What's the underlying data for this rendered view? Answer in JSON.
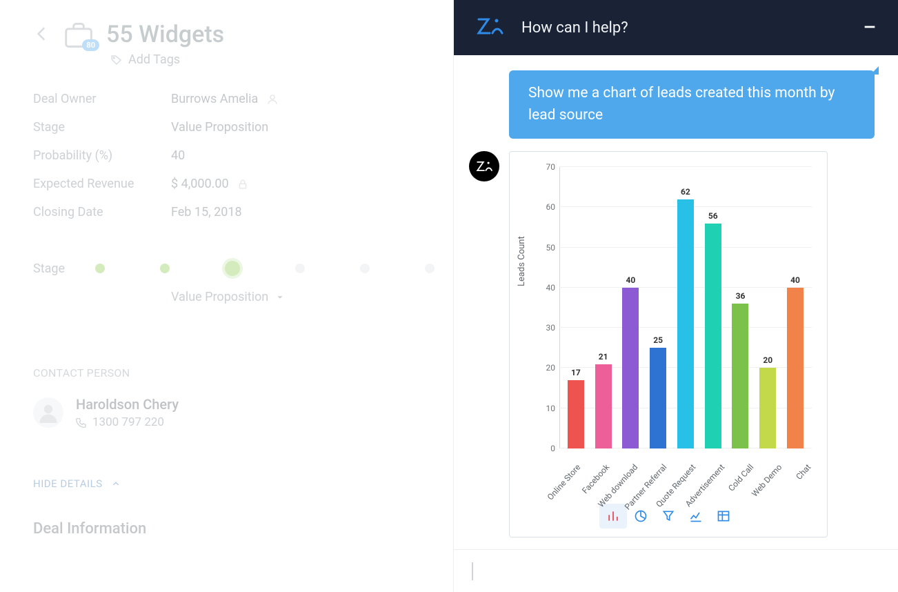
{
  "deal": {
    "title": "55 Widgets",
    "badge": "80",
    "add_tags_label": "Add Tags",
    "fields": {
      "owner_label": "Deal Owner",
      "owner_value": "Burrows Amelia",
      "stage_label": "Stage",
      "stage_value": "Value Proposition",
      "probability_label": "Probability (%)",
      "probability_value": "40",
      "revenue_label": "Expected Revenue",
      "revenue_value": "$ 4,000.00",
      "closing_label": "Closing Date",
      "closing_value": "Feb 15, 2018"
    },
    "stage_progress_label": "Stage",
    "stage_select_value": "Value Proposition",
    "contact_section": "CONTACT PERSON",
    "contact_name": "Haroldson Chery",
    "contact_phone": "1300 797 220",
    "hide_details": "HIDE DETAILS",
    "deal_info_heading": "Deal Information"
  },
  "zia": {
    "header_title": "How can I help?",
    "user_message": "Show me a chart of leads created this month by lead source"
  },
  "chart_data": {
    "type": "bar",
    "ylabel": "Leads Count",
    "ylim": [
      0,
      70
    ],
    "yticks": [
      0,
      10,
      20,
      30,
      40,
      50,
      60,
      70
    ],
    "categories": [
      "Online Store",
      "Facebook",
      "Web download",
      "Partner Referral",
      "Quote Request",
      "Advertisement",
      "Cold Call",
      "Web Demo",
      "Chat"
    ],
    "values": [
      17,
      21,
      40,
      25,
      62,
      56,
      36,
      20,
      40
    ],
    "colors": [
      "#ef5350",
      "#ec5f99",
      "#8c5bd4",
      "#2e73d2",
      "#29c0e7",
      "#1fd0b2",
      "#7bc24b",
      "#c3d94a",
      "#f0824a"
    ]
  }
}
